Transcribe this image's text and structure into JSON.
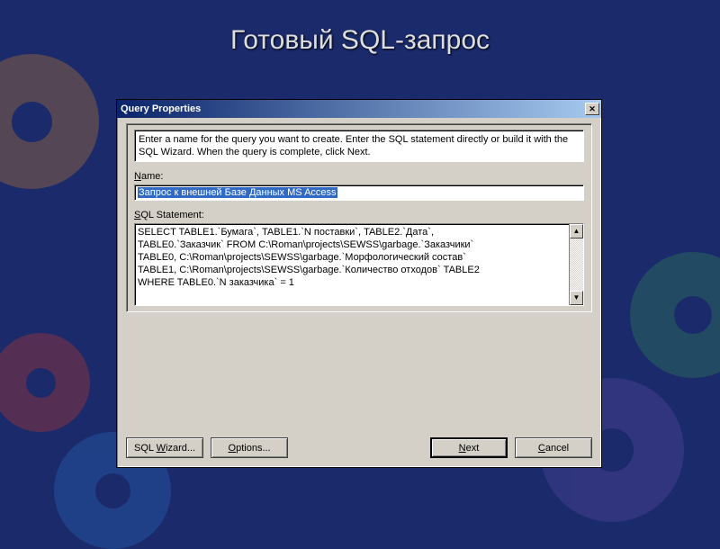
{
  "slide": {
    "title": "Готовый SQL-запрос"
  },
  "dialog": {
    "title": "Query Properties",
    "close_glyph": "✕",
    "instructions": "Enter a name for the query you want to create. Enter the SQL statement directly or build it with the SQL Wizard.  When the query is complete, click Next.",
    "name_label_u": "N",
    "name_label_rest": "ame:",
    "name_value": "Запрос к внешней Базе Данных MS Access",
    "sql_label_u": "S",
    "sql_label_rest": "QL Statement:",
    "sql_value": "SELECT TABLE1.`Бумага`, TABLE1.`N поставки`, TABLE2.`Дата`,\nTABLE0.`Заказчик` FROM C:\\Roman\\projects\\SEWSS\\garbage.`Заказчики`\nTABLE0, C:\\Roman\\projects\\SEWSS\\garbage.`Морфологический состав`\nTABLE1, C:\\Roman\\projects\\SEWSS\\garbage.`Количество отходов` TABLE2\nWHERE TABLE0.`N заказчика` = 1",
    "scroll_up": "▲",
    "scroll_down": "▼",
    "buttons": {
      "wizard_pre": "SQL ",
      "wizard_u": "W",
      "wizard_post": "izard...",
      "options_u": "O",
      "options_post": "ptions...",
      "next_u": "N",
      "next_post": "ext",
      "cancel_u": "C",
      "cancel_post": "ancel"
    }
  }
}
